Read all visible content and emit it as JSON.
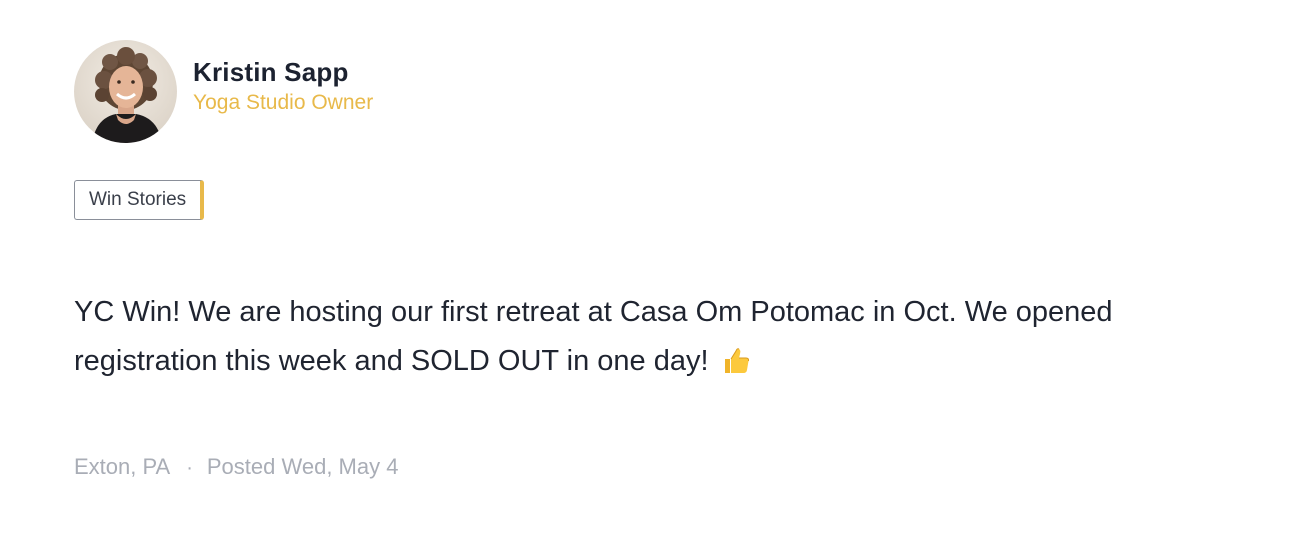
{
  "author": {
    "name": "Kristin Sapp",
    "role": "Yoga Studio Owner"
  },
  "tag": {
    "label": "Win Stories"
  },
  "post": {
    "message": "YC Win! We are hosting our first retreat at Casa Om Potomac in Oct. We opened registration this week and SOLD OUT in one day!",
    "emoji": "thumbs-up-icon"
  },
  "meta": {
    "location": "Exton, PA",
    "separator": "·",
    "posted": "Posted Wed, May 4"
  },
  "colors": {
    "accent": "#e8b94a",
    "text": "#1f2430",
    "muted": "#a9adb6"
  }
}
